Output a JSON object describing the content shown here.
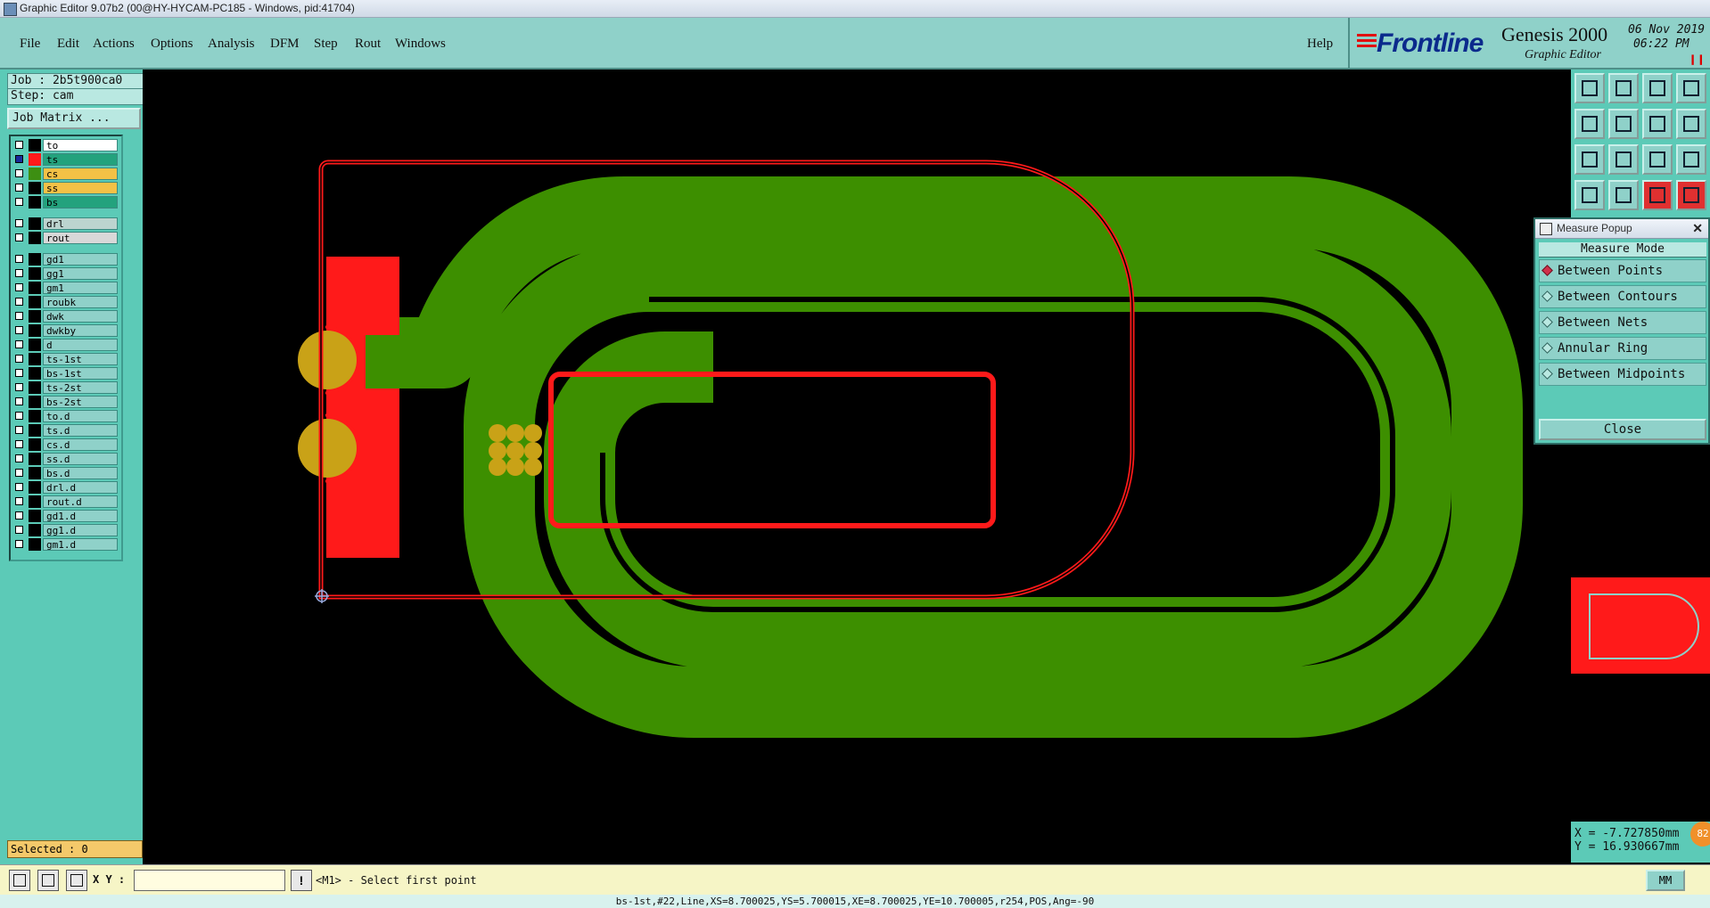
{
  "window": {
    "title": "Graphic Editor 9.07b2 (00@HY-HYCAM-PC185 - Windows, pid:41704)"
  },
  "menu": {
    "items": [
      "File",
      "Edit",
      "Actions",
      "Options",
      "Analysis",
      "DFM",
      "Step",
      "Rout",
      "Windows"
    ],
    "help": "Help"
  },
  "logo": {
    "brand": "Frontline",
    "product": "Genesis 2000",
    "subtitle": "Graphic Editor",
    "date": "06 Nov 2019",
    "time": "06:22 PM"
  },
  "job": {
    "job": "Job : 2b5t900ca0",
    "step": "Step: cam",
    "matrix_button": "Job Matrix ..."
  },
  "layers": [
    {
      "name": "to",
      "color": "#ffffff",
      "swatch": "#000000"
    },
    {
      "name": "ts",
      "color": "#23a27d",
      "swatch": "#ff1a1a",
      "active": true
    },
    {
      "name": "cs",
      "color": "#f4c146",
      "swatch": "#3d8f12"
    },
    {
      "name": "ss",
      "color": "#f4c146",
      "swatch": "#000000"
    },
    {
      "name": "bs",
      "color": "#23a27d",
      "swatch": "#000000"
    },
    {
      "name": "drl",
      "color": "#bcd4cf",
      "swatch": "#000000"
    },
    {
      "name": "rout",
      "color": "#d8d8d8",
      "swatch": "#000000"
    },
    {
      "name": "gd1",
      "color": "#8fd1c9",
      "swatch": "#000000"
    },
    {
      "name": "gg1",
      "color": "#8fd1c9",
      "swatch": "#000000"
    },
    {
      "name": "gm1",
      "color": "#8fd1c9",
      "swatch": "#000000"
    },
    {
      "name": "roubk",
      "color": "#8fd1c9",
      "swatch": "#000000"
    },
    {
      "name": "dwk",
      "color": "#8fd1c9",
      "swatch": "#000000"
    },
    {
      "name": "dwkby",
      "color": "#8fd1c9",
      "swatch": "#000000"
    },
    {
      "name": "d",
      "color": "#8fd1c9",
      "swatch": "#000000"
    },
    {
      "name": "ts-1st",
      "color": "#8fd1c9",
      "swatch": "#000000"
    },
    {
      "name": "bs-1st",
      "color": "#8fd1c9",
      "swatch": "#000000"
    },
    {
      "name": "ts-2st",
      "color": "#8fd1c9",
      "swatch": "#000000"
    },
    {
      "name": "bs-2st",
      "color": "#8fd1c9",
      "swatch": "#000000"
    },
    {
      "name": "to.d",
      "color": "#8fd1c9",
      "swatch": "#000000"
    },
    {
      "name": "ts.d",
      "color": "#8fd1c9",
      "swatch": "#000000"
    },
    {
      "name": "cs.d",
      "color": "#8fd1c9",
      "swatch": "#000000"
    },
    {
      "name": "ss.d",
      "color": "#8fd1c9",
      "swatch": "#000000"
    },
    {
      "name": "bs.d",
      "color": "#8fd1c9",
      "swatch": "#000000"
    },
    {
      "name": "drl.d",
      "color": "#8fd1c9",
      "swatch": "#000000"
    },
    {
      "name": "rout.d",
      "color": "#8fd1c9",
      "swatch": "#000000"
    },
    {
      "name": "gd1.d",
      "color": "#8fd1c9",
      "swatch": "#000000"
    },
    {
      "name": "gg1.d",
      "color": "#8fd1c9",
      "swatch": "#000000"
    },
    {
      "name": "gm1.d",
      "color": "#8fd1c9",
      "swatch": "#000000"
    }
  ],
  "selected": "Selected : 0",
  "measure_popup": {
    "title": "Measure Popup",
    "mode_header": "Measure Mode",
    "options": [
      "Between Points",
      "Between Contours",
      "Between Nets",
      "Annular Ring",
      "Between Midpoints"
    ],
    "selected_option": "Between Points",
    "close_label": "Close"
  },
  "coords": {
    "x": "X = -7.727850mm",
    "y": "Y = 16.930667mm",
    "badge": "82"
  },
  "status": {
    "xy_label": "X Y :",
    "xy_value": "",
    "excl": "!",
    "prompt": "<M1> - Select first point",
    "unit": "MM",
    "footer": "bs-1st,#22,Line,XS=8.700025,YS=5.700015,XE=8.700025,YE=10.700005,r254,POS,Ang=-90"
  },
  "colors": {
    "panel": "#5ccab7",
    "menubar": "#8fd1c9",
    "copper_red": "#ff1a1a",
    "copper_green": "#3d8f00",
    "pad_gold": "#c9a217"
  }
}
